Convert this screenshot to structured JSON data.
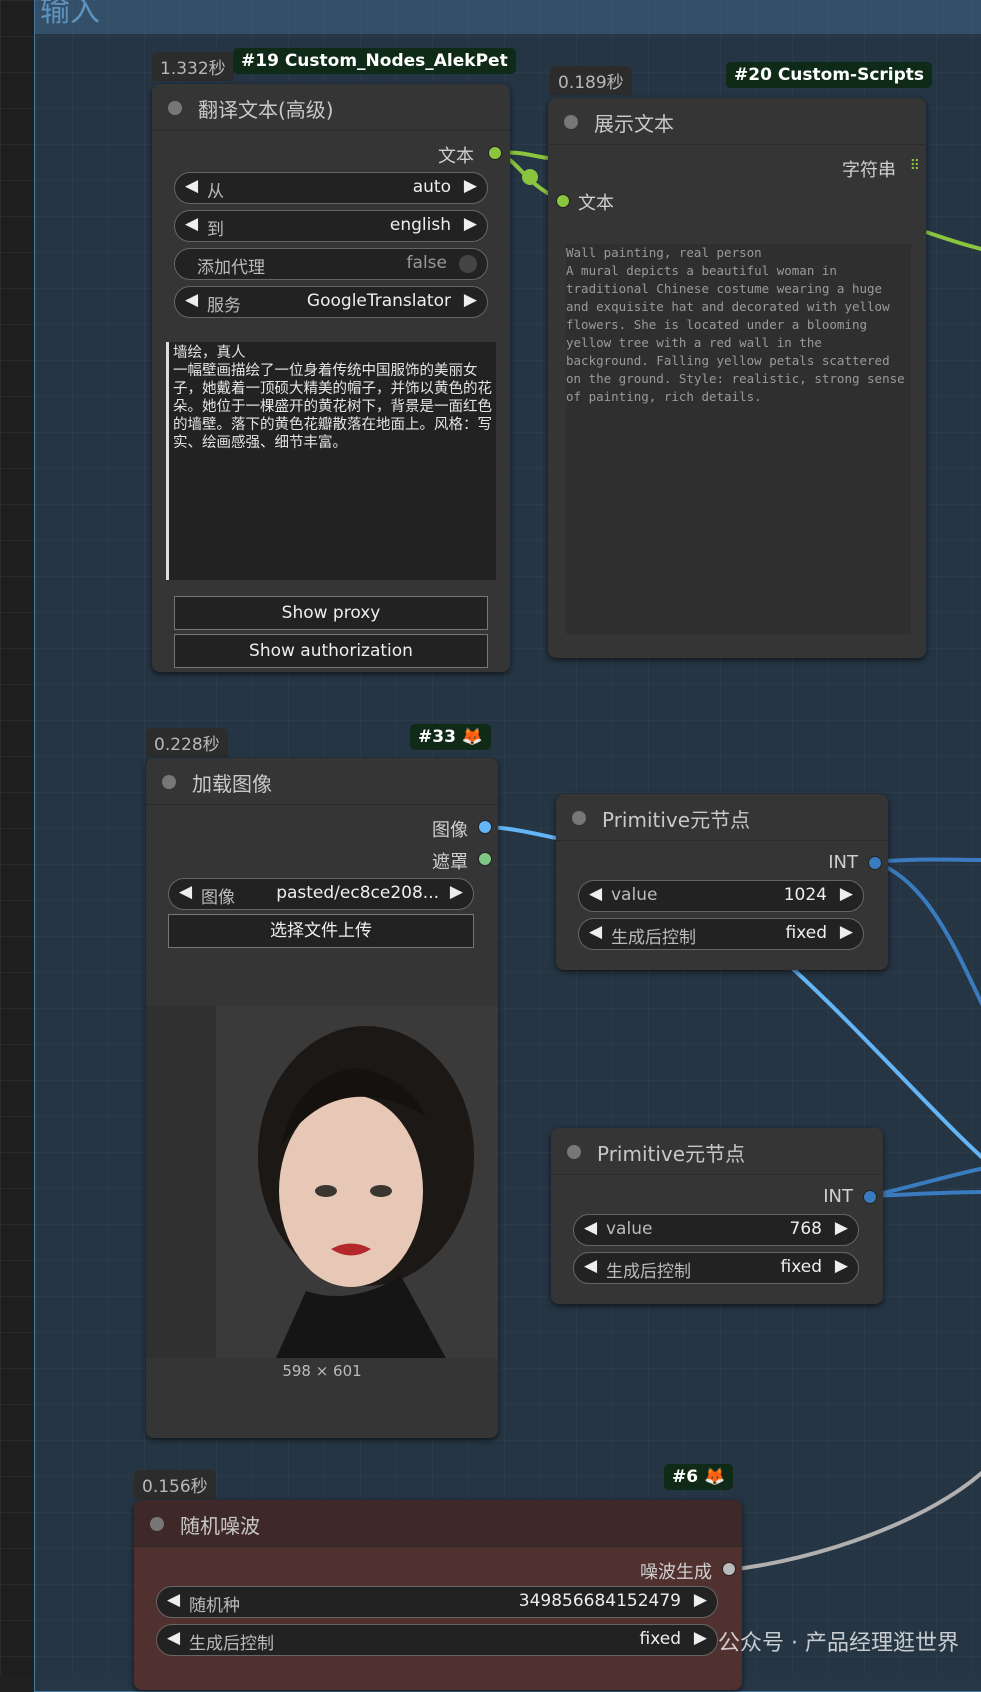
{
  "group": {
    "title": "输入"
  },
  "translate_node": {
    "time": "1.332秒",
    "id_badge": "#19 Custom_Nodes_AlekPet",
    "title": "翻译文本(高级)",
    "output_label": "文本",
    "widgets": [
      {
        "label": "从",
        "value": "auto"
      },
      {
        "label": "到",
        "value": "english"
      },
      {
        "label": "添加代理",
        "value": "false"
      },
      {
        "label": "服务",
        "value": "GoogleTranslator"
      }
    ],
    "text": "墙绘，真人\n一幅壁画描绘了一位身着传统中国服饰的美丽女子，她戴着一顶硕大精美的帽子，并饰以黄色的花朵。她位于一棵盛开的黄花树下，背景是一面红色的墙壁。落下的黄色花瓣散落在地面上。风格：写实、绘画感强、细节丰富。",
    "buttons": [
      "Show proxy",
      "Show authorization"
    ]
  },
  "show_text_node": {
    "time": "0.189秒",
    "id_badge": "#20 Custom-Scripts",
    "title": "展示文本",
    "output_label": "字符串",
    "input_label": "文本",
    "text": "Wall painting, real person\nA mural depicts a beautiful woman in traditional Chinese costume wearing a huge and exquisite hat and decorated with yellow flowers. She is located under a blooming yellow tree with a red wall in the background. Falling yellow petals scattered on the ground. Style: realistic, strong sense of painting, rich details."
  },
  "load_image_node": {
    "time": "0.228秒",
    "id_badge": "#33 🦊",
    "title": "加载图像",
    "outputs": [
      "图像",
      "遮罩"
    ],
    "image_widget": {
      "label": "图像",
      "value": "pasted/ec8ce208..."
    },
    "upload_button": "选择文件上传",
    "image_size": "598 × 601"
  },
  "primitive_nodes": [
    {
      "title": "Primitive元节点",
      "output": "INT",
      "value_label": "value",
      "value": "1024",
      "control_label": "生成后控制",
      "control_value": "fixed"
    },
    {
      "title": "Primitive元节点",
      "output": "INT",
      "value_label": "value",
      "value": "768",
      "control_label": "生成后控制",
      "control_value": "fixed"
    }
  ],
  "noise_node": {
    "time": "0.156秒",
    "id_badge": "#6 🦊",
    "title": "随机噪波",
    "output_label": "噪波生成",
    "seed_label": "随机种",
    "seed_value": "349856684152479",
    "control_label": "生成后控制",
    "control_value": "fixed"
  },
  "watermark": "公众号 · 产品经理逛世界",
  "colors": {
    "string_link": "#8bc53f",
    "int_link": "#3a7bbf",
    "image_link": "#64b5f6",
    "noise_link": "#b0b0b0"
  }
}
